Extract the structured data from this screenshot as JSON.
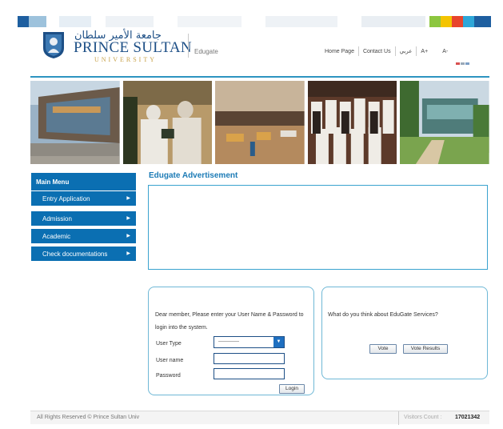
{
  "header": {
    "logo_arabic": "جامعة الأمير سلطان",
    "logo_english": "PRINCE SULTAN",
    "logo_university": "UNIVERSITY",
    "site_title": "Edugate",
    "nav": {
      "home": "Home Page",
      "contact": "Contact Us",
      "arabic": "عربي",
      "font_increase": "A+",
      "font_decrease": "A-"
    }
  },
  "colors": {
    "brand_blue": "#0b6fb2",
    "accent_cyan": "#2d94c1",
    "logo_gold": "#c8a24a"
  },
  "photos": [
    "building-photo",
    "officials-photo",
    "hall-photo",
    "group-photo",
    "campus-photo"
  ],
  "menu": {
    "title": "Main Menu",
    "items": [
      {
        "label": "Entry Application"
      },
      {
        "label": "Admission"
      },
      {
        "label": "Academic"
      },
      {
        "label": "Check documentations"
      }
    ]
  },
  "advertisement": {
    "title": "Edugate Advertisement"
  },
  "login": {
    "message": "Dear member, Please enter your User Name & Password to login into the system.",
    "user_type_label": "User Type",
    "user_type_value": "-------------",
    "username_label": "User name",
    "password_label": "Password",
    "login_button": "Login"
  },
  "poll": {
    "question": "What do you think about EduGate Services?",
    "vote_button": "Vote",
    "results_button": "Vote Results"
  },
  "footer": {
    "copyright": "All Rights Reserved © Prince Sultan Univ",
    "visitors_label": "Visitors Count :",
    "visitors_count": "17021342"
  }
}
